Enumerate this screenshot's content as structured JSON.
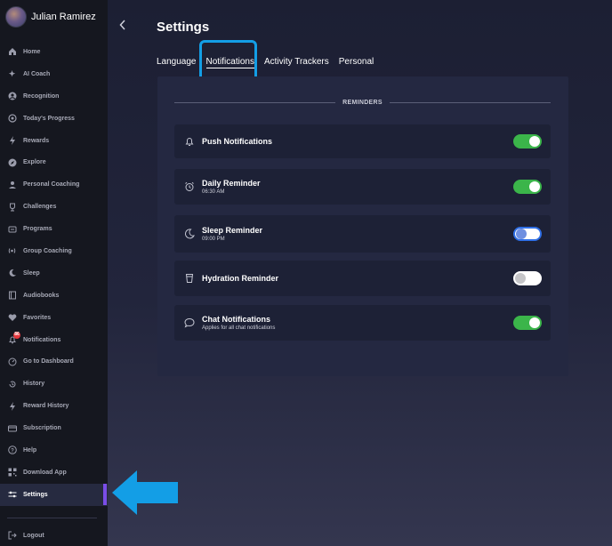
{
  "user": {
    "name": "Julian Ramirez"
  },
  "sidebar": {
    "items": [
      {
        "label": "Home",
        "icon": "home-icon"
      },
      {
        "label": "AI Coach",
        "icon": "sparkle-icon"
      },
      {
        "label": "Recognition",
        "icon": "user-circle-icon"
      },
      {
        "label": "Today's Progress",
        "icon": "progress-icon"
      },
      {
        "label": "Rewards",
        "icon": "bolt-icon"
      },
      {
        "label": "Explore",
        "icon": "compass-icon"
      },
      {
        "label": "Personal Coaching",
        "icon": "coach-icon"
      },
      {
        "label": "Challenges",
        "icon": "trophy-icon"
      },
      {
        "label": "Programs",
        "icon": "programs-icon"
      },
      {
        "label": "Group Coaching",
        "icon": "broadcast-icon"
      },
      {
        "label": "Sleep",
        "icon": "moon-icon"
      },
      {
        "label": "Audiobooks",
        "icon": "book-icon"
      },
      {
        "label": "Favorites",
        "icon": "heart-icon"
      },
      {
        "label": "Notifications",
        "icon": "bell-icon",
        "badge": "86"
      },
      {
        "label": "Go to Dashboard",
        "icon": "dashboard-icon"
      },
      {
        "label": "History",
        "icon": "history-icon"
      },
      {
        "label": "Reward History",
        "icon": "bolt-icon"
      },
      {
        "label": "Subscription",
        "icon": "card-icon"
      },
      {
        "label": "Help",
        "icon": "help-icon"
      },
      {
        "label": "Download App",
        "icon": "qr-icon"
      },
      {
        "label": "Settings",
        "icon": "sliders-icon",
        "active": true
      }
    ],
    "logout_label": "Logout"
  },
  "page": {
    "title": "Settings"
  },
  "tabs": [
    {
      "label": "Language",
      "active": false
    },
    {
      "label": "Notifications",
      "active": true
    },
    {
      "label": "Activity Trackers",
      "active": false
    },
    {
      "label": "Personal",
      "active": false
    }
  ],
  "reminders": {
    "section_label": "REMINDERS",
    "items": [
      {
        "title": "Push Notifications",
        "subtitle": "",
        "icon": "bell-icon",
        "enabled": true
      },
      {
        "title": "Daily Reminder",
        "subtitle": "06:30 AM",
        "icon": "alarm-clock-icon",
        "enabled": true
      },
      {
        "title": "Sleep Reminder",
        "subtitle": "09:00 PM",
        "icon": "moon-icon",
        "enabled": false
      },
      {
        "title": "Hydration Reminder",
        "subtitle": "",
        "icon": "cup-icon",
        "enabled": false
      },
      {
        "title": "Chat Notifications",
        "subtitle": "Applies for all chat notifications",
        "icon": "chat-bubble-icon",
        "enabled": true
      }
    ]
  },
  "colors": {
    "accent_toggle_on": "#3bb54a",
    "highlight_annotation": "#139ee6",
    "active_indicator": "#7a4de8",
    "sidebar_bg": "#15171f"
  }
}
